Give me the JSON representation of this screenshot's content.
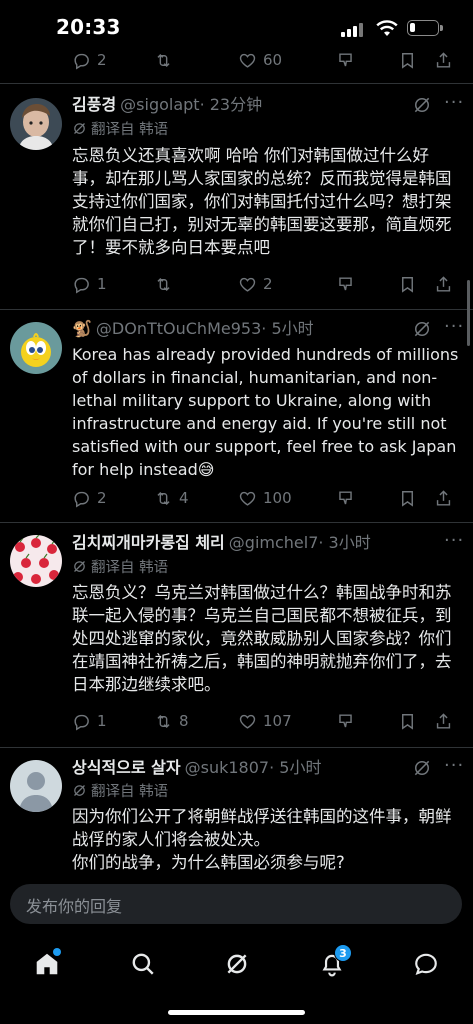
{
  "status_bar": {
    "time": "20:33",
    "battery_level": 0.2
  },
  "top_actions": {
    "replies": "2",
    "retweets": "",
    "likes": "60"
  },
  "tweets": [
    {
      "name": "김풍경",
      "handle": "@sigolapt",
      "time": "· 23分钟",
      "translate": "翻译自 韩语",
      "body": "忘恩负义还真喜欢啊 哈哈 你们对韩国做过什么好事，却在那儿骂人家国家的总统？反而我觉得是韩国支持过你们国家，你们对韩国托付过什么吗？想打架就你们自己打，别对无辜的韩国要这要那，简直烦死了！要不就多向日本要点吧",
      "replies": "1",
      "retweets": "",
      "likes": "2",
      "avatar": "avatar-photo"
    },
    {
      "name": "🐒",
      "handle": "@DOnTtOuChMe953",
      "time": "· 5小时",
      "body": "Korea has already provided hundreds of millions of dollars in financial, humanitarian, and non-lethal military support to Ukraine, along with infrastructure and energy aid. If you're still not satisfied with our support, feel free to ask Japan for help instead😅",
      "replies": "2",
      "retweets": "4",
      "likes": "100",
      "avatar": "avatar-tweety"
    },
    {
      "name": "김치찌개마카롱집 체리",
      "handle": "@gimchel7",
      "time": "· 3小时",
      "translate": "翻译自 韩语",
      "body": "忘恩负义？乌克兰对韩国做过什么？韩国战争时和苏联一起入侵的事？乌克兰自己国民都不想被征兵，到处四处逃窜的家伙，竟然敢威胁别人国家参战？你们在靖国神社祈祷之后，韩国的神明就抛弃你们了，去日本那边继续求吧。",
      "replies": "1",
      "retweets": "8",
      "likes": "107",
      "avatar": "avatar-cherries"
    },
    {
      "name": "상식적으로 살자",
      "handle": "@suk1807",
      "time": "· 5小时",
      "translate": "翻译自 韩语",
      "body": "因为你们公开了将朝鲜战俘送往韩国的这件事，朝鲜战俘的家人们将会被处决。\n你们的战争，为什么韩国必须参与呢?",
      "avatar": "avatar-default"
    }
  ],
  "reply_box": {
    "placeholder": "发布你的回复"
  },
  "tab_bar": {
    "items": [
      "home-icon",
      "search-icon",
      "grok-icon",
      "notifications-icon",
      "messages-icon"
    ],
    "notifications_badge": "3"
  },
  "colors": {
    "background": "#000000",
    "text": "#e7e9ea",
    "secondary": "#71767b",
    "accent": "#1d9bf0",
    "divider": "#2f3336"
  }
}
